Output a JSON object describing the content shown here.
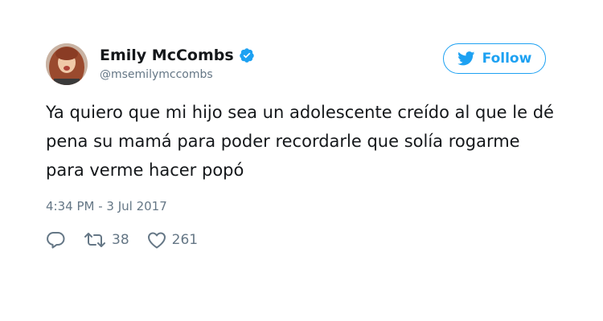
{
  "tweet": {
    "author": {
      "display_name": "Emily McCombs",
      "handle": "@msemilymccombs",
      "verified_icon": "verified-badge-icon",
      "avatar": "profile-photo"
    },
    "follow_button": {
      "label": "Follow",
      "icon": "twitter-bird-icon"
    },
    "text": "Ya quiero que mi hijo sea un adolescente creído al que le dé pena su mamá para poder recordarle que solía rogarme para verme hacer popó",
    "timestamp": "4:34 PM - 3 Jul 2017",
    "actions": {
      "reply_icon": "reply-icon",
      "retweet_icon": "retweet-icon",
      "retweets": "38",
      "like_icon": "heart-icon",
      "likes": "261"
    }
  },
  "colors": {
    "brand_blue": "#1da1f2",
    "text_primary": "#14171a",
    "text_secondary": "#657786"
  }
}
